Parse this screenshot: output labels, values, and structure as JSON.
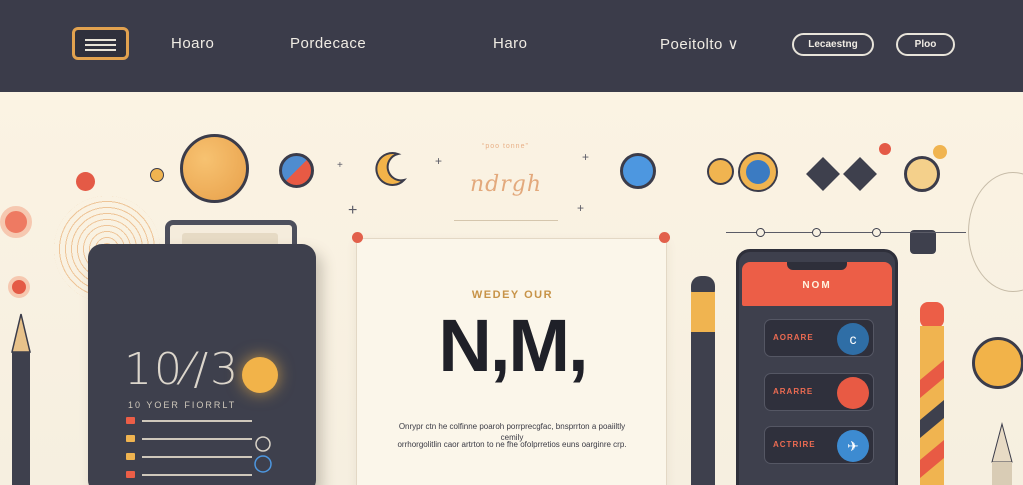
{
  "nav": {
    "items": [
      "Hoaro",
      "Pordecace",
      "Haro",
      "Poeitolto ∨"
    ],
    "pills": [
      "Lecaestng",
      "Ploo"
    ]
  },
  "clipboard": {
    "number": "10⁄/3",
    "caption": "10 YOER FIORRLT"
  },
  "logo": {
    "top_text": "“poo tonne”",
    "script": "ndrgh"
  },
  "card": {
    "eyebrow": "WEDEY OUR",
    "headline": "N,M,",
    "body_line1": "Onrypr ctn he colfinne poaroh porrprecgfac, bnsprrton a poaiiltly cemily",
    "body_line2": "orrhorgolitlin caor artrton to ne fhe ofolprretios euns oarginre crp."
  },
  "phone": {
    "title": "NOM",
    "rows": [
      {
        "label": "AORARE",
        "icon": "c",
        "color": "#2f6ea6"
      },
      {
        "label": "ARARRE",
        "icon": "",
        "color": "#e85a44"
      },
      {
        "label": "ACTRIRE",
        "icon": "✈",
        "color": "#3d8bd1"
      }
    ]
  },
  "colors": {
    "navbar": "#3b3c4a",
    "accent_orange": "#f2b349",
    "accent_red": "#ec5e47",
    "accent_blue": "#3d8bd1",
    "background": "#f8f1e2"
  }
}
